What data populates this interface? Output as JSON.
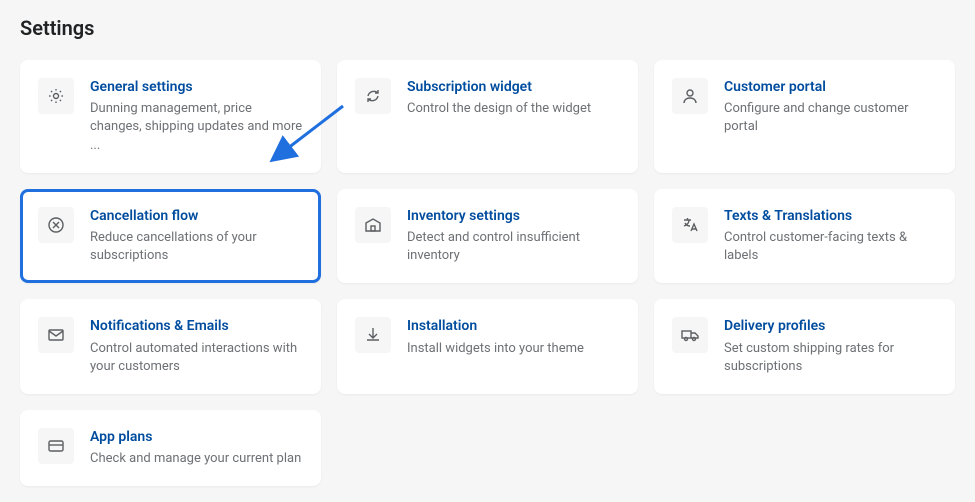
{
  "page_title": "Settings",
  "colors": {
    "accent": "#1f6fde",
    "link": "#004c9e"
  },
  "cards": [
    {
      "id": "general-settings",
      "title": "General settings",
      "desc": "Dunning management, price changes, shipping updates and more ...",
      "icon": "gear-icon",
      "highlighted": false
    },
    {
      "id": "subscription-widget",
      "title": "Subscription widget",
      "desc": "Control the design of the widget",
      "icon": "refresh-icon",
      "highlighted": false
    },
    {
      "id": "customer-portal",
      "title": "Customer portal",
      "desc": "Configure and change customer portal",
      "icon": "person-icon",
      "highlighted": false
    },
    {
      "id": "cancellation-flow",
      "title": "Cancellation flow",
      "desc": "Reduce cancellations of your subscriptions",
      "icon": "cancel-icon",
      "highlighted": true
    },
    {
      "id": "inventory-settings",
      "title": "Inventory settings",
      "desc": "Detect and control insufficient inventory",
      "icon": "inventory-icon",
      "highlighted": false
    },
    {
      "id": "texts-translations",
      "title": "Texts & Translations",
      "desc": "Control customer-facing texts & labels",
      "icon": "translate-icon",
      "highlighted": false
    },
    {
      "id": "notifications-emails",
      "title": "Notifications & Emails",
      "desc": "Control automated interactions with your customers",
      "icon": "mail-icon",
      "highlighted": false
    },
    {
      "id": "installation",
      "title": "Installation",
      "desc": "Install widgets into your theme",
      "icon": "download-icon",
      "highlighted": false
    },
    {
      "id": "delivery-profiles",
      "title": "Delivery profiles",
      "desc": "Set custom shipping rates for subscriptions",
      "icon": "truck-icon",
      "highlighted": false
    },
    {
      "id": "app-plans",
      "title": "App plans",
      "desc": "Check and manage your current plan",
      "icon": "card-icon",
      "highlighted": false
    }
  ]
}
